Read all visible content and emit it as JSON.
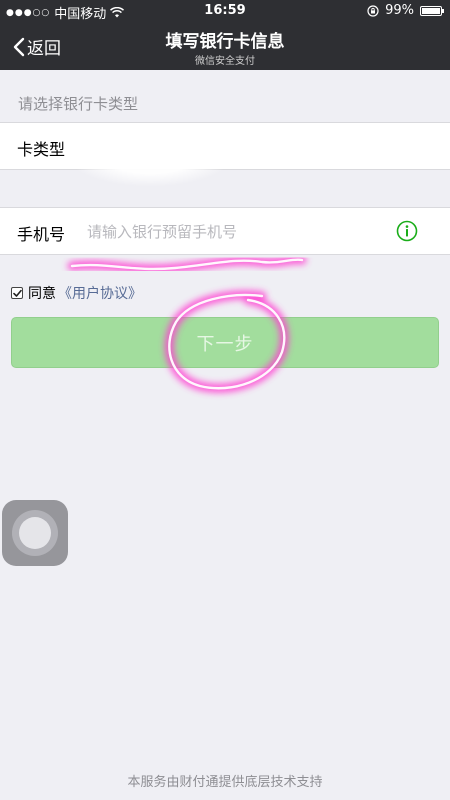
{
  "status_bar": {
    "signal_dots": "●●●○○",
    "carrier": "中国移动",
    "time": "16:59",
    "battery": "99%",
    "battery_level": 0.99
  },
  "nav": {
    "back_label": "返回",
    "title": "填写银行卡信息",
    "subtitle": "微信安全支付"
  },
  "form": {
    "section_hint": "请选择银行卡类型",
    "card_type_label": "卡类型",
    "phone_label": "手机号",
    "phone_placeholder": "请输入银行预留手机号"
  },
  "agreement": {
    "checked": true,
    "agree_text": "同意",
    "link_text": "《用户协议》"
  },
  "next_button": {
    "label": "下一步",
    "enabled": false
  },
  "footer": {
    "text": "本服务由财付通提供底层技术支持"
  },
  "colors": {
    "nav_bg": "#2e2f33",
    "button_disabled": "#a2dd9d",
    "link": "#576b95",
    "info_icon": "#1aad19",
    "annotation": "#ff3fd2"
  },
  "icons": {
    "back": "chevron-left-icon",
    "wifi": "wifi-icon",
    "lock": "orientation-lock-icon",
    "battery": "battery-icon",
    "info": "info-icon",
    "check": "checkmark-icon"
  }
}
